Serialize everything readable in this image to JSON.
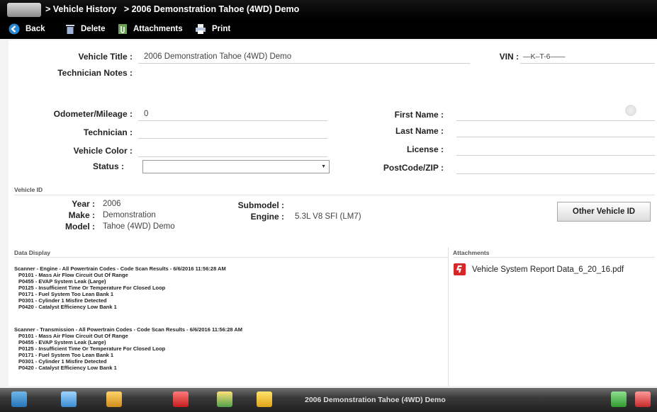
{
  "titlebar": {
    "crumb1": "> Vehicle History",
    "crumb2": "> 2006 Demonstration Tahoe (4WD) Demo"
  },
  "toolbar": {
    "back_label": "Back",
    "delete_label": "Delete",
    "attachments_label": "Attachments",
    "print_label": "Print"
  },
  "form": {
    "vehicle_title_label": "Vehicle Title :",
    "vehicle_title_value": "2006 Demonstration Tahoe (4WD) Demo",
    "vin_label": "VIN :",
    "vin_value": "—K–T-6——",
    "tech_notes_label": "Technician Notes :",
    "odometer_label": "Odometer/Mileage :",
    "odometer_value": "0",
    "technician_label": "Technician :",
    "color_label": "Vehicle Color :",
    "status_label": "Status :",
    "first_name_label": "First Name :",
    "last_name_label": "Last Name :",
    "license_label": "License :",
    "postcode_label": "PostCode/ZIP :"
  },
  "vehicle_id": {
    "section_label": "Vehicle ID",
    "year_label": "Year :",
    "year_value": "2006",
    "make_label": "Make :",
    "make_value": "Demonstration",
    "model_label": "Model :",
    "model_value": "Tahoe (4WD) Demo",
    "submodel_label": "Submodel :",
    "engine_label": "Engine :",
    "engine_value": "5.3L V8 SFI (LM7)",
    "other_button": "Other Vehicle ID"
  },
  "data_display": {
    "label": "Data Display",
    "groups": [
      {
        "header": "Scanner - Engine - All Powertrain Codes - Code Scan Results - 6/6/2016 11:56:28 AM",
        "codes": [
          "P0101 - Mass Air Flow Circuit Out Of Range",
          "P0455 - EVAP System Leak (Large)",
          "P0125 - Insufficient Time Or Temperature For Closed Loop",
          "P0171 - Fuel System Too Lean Bank 1",
          "P0301 - Cylinder 1 Misfire Detected",
          "P0420 - Catalyst Efficiency Low Bank 1"
        ]
      },
      {
        "header": "Scanner - Transmission - All Powertrain Codes - Code Scan Results - 6/6/2016 11:56:28 AM",
        "codes": [
          "P0101 - Mass Air Flow Circuit Out Of Range",
          "P0455 - EVAP System Leak (Large)",
          "P0125 - Insufficient Time Or Temperature For Closed Loop",
          "P0171 - Fuel System Too Lean Bank 1",
          "P0301 - Cylinder 1 Misfire Detected",
          "P0420 - Catalyst Efficiency Low Bank 1"
        ]
      }
    ]
  },
  "attachments": {
    "label": "Attachments",
    "file": "Vehicle System Report Data_6_20_16.pdf"
  },
  "taskbar": {
    "title": "2006 Demonstration Tahoe (4WD) Demo"
  },
  "colors": {
    "bar_bg": "#000000",
    "accent_red": "#d62828",
    "back_icon": "#2a8ad1"
  },
  "icons": {
    "back": "back-arrow-icon",
    "delete": "trash-icon",
    "attachments": "paperclip-icon",
    "print": "printer-icon",
    "pdf": "snapon-pdf-icon"
  }
}
